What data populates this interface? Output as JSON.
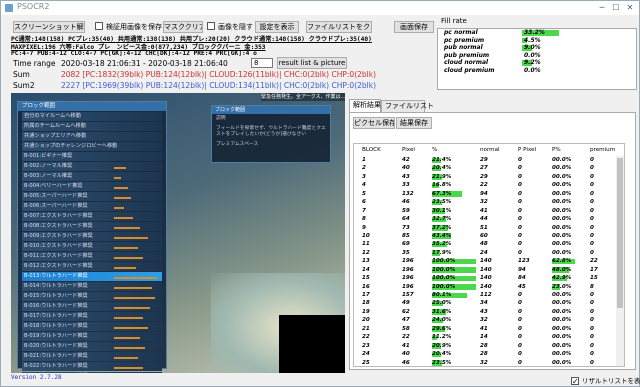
{
  "window": {
    "title": "PSOCR2"
  },
  "toolbar": {
    "screenshot_analyze": "スクリーンショット解析",
    "save_verify_image": "検証用画像を保存",
    "mask_clear": "マスククリア",
    "hide_image": "画像を隠す",
    "show_settings": "設定を表示",
    "clear_file_list": "ファイルリストをクリア",
    "save_screen": "画面保存"
  },
  "info_lines": [
    "PC通常:148(158) PCプレ:35(40) 共用通常:138(138) 共用プレ:20(20) クラウド通常:148(158) クラウドプレ:35(40)",
    "MAXPIXEL:196 六等:Falco プレ　ンピース金:0(877,234) ブロッククパーニ 金:353",
    "PC:4-7 PUB:4-12 CLO:4-7 PC[GK]:4-12 CHC[DK]:4-12 PRE:4 PRC[GK]:4 o"
  ],
  "time_range": {
    "label": "Time range",
    "value": "2020-03-18 21:06:31 - 2020-03-18 21:06:40",
    "field": "8",
    "result_button": "result list & picture"
  },
  "sum": {
    "label": "Sum",
    "value": "2082 [PC:1832(39blk) PUB:124(12blk)| CLOUD:126(11blk)| CHC:0(2blk) CHP:0(2blk)"
  },
  "sum2": {
    "label": "Sum2",
    "value": "2227 [PC:1969(39blk) PUB:124(12blk)| CLOUD:134(11blk)| CHC:0(2blk) CHP:0(2blk)"
  },
  "fill_rate": {
    "title": "Fill rate",
    "rows": [
      {
        "name": "pc normal",
        "value": "33.2%",
        "frac": 0.332
      },
      {
        "name": "pc premium",
        "value": "4.5%",
        "frac": 0.045
      },
      {
        "name": "pub normal",
        "value": "9.0%",
        "frac": 0.09
      },
      {
        "name": "pub premium",
        "value": "0.0%",
        "frac": 0
      },
      {
        "name": "cloud normal",
        "value": "9.2%",
        "frac": 0.092
      },
      {
        "name": "cloud premium",
        "value": "0.0%",
        "frac": 0
      }
    ]
  },
  "game": {
    "block_list_title": "ブロック範囲",
    "block_info_title": "ブロック範囲",
    "notice": "緊急任務発生。全アークス、作業は…",
    "info_label": "説明",
    "info_text": "フィールドを探索せず、ウルトラハード難度とクエストをプレイしたいか(どうか)選びなさい",
    "premium_label": "プレミアムスペース",
    "blocks": [
      {
        "label": "自分のマイルームへ移動",
        "level": 0
      },
      {
        "label": "所属のチームルームへ移動",
        "level": 0
      },
      {
        "label": "共通ショップエリアへ移動",
        "level": 0
      },
      {
        "label": "共通ショップのチャレンジロビーへ移動",
        "level": 0
      },
      {
        "label": "B-001:ビギナー推奨",
        "level": 0
      },
      {
        "label": "B-002:ノーマル推奨",
        "level": 0.25
      },
      {
        "label": "B-003:ノーマル推奨",
        "level": 0.15
      },
      {
        "label": "B-004:ベリーハード推奨",
        "level": 0.3
      },
      {
        "label": "B-005:スーパーハード推奨",
        "level": 0.35
      },
      {
        "label": "B-006:スーパーハード推奨",
        "level": 0.2
      },
      {
        "label": "B-007:エクストラハード推奨",
        "level": 0.4
      },
      {
        "label": "B-008:エクストラハード推奨",
        "level": 0.55
      },
      {
        "label": "B-009:エクストラハード推奨",
        "level": 0.7
      },
      {
        "label": "B-010:エクストラハード推奨",
        "level": 0.5
      },
      {
        "label": "B-011:エクストラハード推奨",
        "level": 0.6
      },
      {
        "label": "B-012:エクストラハード推奨",
        "level": 0.45
      },
      {
        "label": "B-013:ウルトラハード推奨",
        "level": 0.9
      },
      {
        "label": "B-014:ウルトラハード推奨",
        "level": 0.8
      },
      {
        "label": "B-015:ウルトラハード推奨",
        "level": 0.85
      },
      {
        "label": "B-016:ウルトラハード推奨",
        "level": 0.75
      },
      {
        "label": "B-017:ウルトラハード推奨",
        "level": 0.6
      },
      {
        "label": "B-018:ウルトラハード推奨",
        "level": 0.7
      },
      {
        "label": "B-019:ウルトラハード推奨",
        "level": 0.55
      },
      {
        "label": "B-020:ウルトラハード推奨",
        "level": 0.65
      },
      {
        "label": "B-021:ウルトラハード推奨",
        "level": 0.5
      },
      {
        "label": "B-022:ウルトラハード推奨",
        "level": 0.6
      },
      {
        "label": "B-023:ウルトラハード推奨",
        "level": 0.45
      }
    ],
    "selected_index": 16
  },
  "results": {
    "tabs": [
      "解析結果",
      "ファイルリスト"
    ],
    "pixel_save": "ピクセル保存",
    "result_save": "結果保存",
    "columns": [
      "BLOCK",
      "Pixel",
      "%",
      "normal",
      "P Pixel",
      "P%",
      "premium"
    ],
    "rows": [
      [
        "1",
        "42",
        "21.4%",
        "29",
        "0",
        "00.0%",
        "0"
      ],
      [
        "2",
        "40",
        "20.4%",
        "27",
        "0",
        "00.0%",
        "0"
      ],
      [
        "3",
        "43",
        "21.9%",
        "29",
        "0",
        "00.0%",
        "0"
      ],
      [
        "4",
        "33",
        "16.8%",
        "22",
        "0",
        "00.0%",
        "0"
      ],
      [
        "5",
        "132",
        "67.3%",
        "94",
        "0",
        "00.0%",
        "0"
      ],
      [
        "6",
        "46",
        "23.5%",
        "32",
        "0",
        "00.0%",
        "0"
      ],
      [
        "7",
        "59",
        "30.1%",
        "41",
        "0",
        "00.0%",
        "0"
      ],
      [
        "8",
        "64",
        "32.7%",
        "44",
        "0",
        "00.0%",
        "0"
      ],
      [
        "9",
        "73",
        "37.2%",
        "51",
        "0",
        "00.0%",
        "0"
      ],
      [
        "10",
        "85",
        "43.4%",
        "60",
        "0",
        "00.0%",
        "0"
      ],
      [
        "11",
        "69",
        "35.2%",
        "48",
        "0",
        "00.0%",
        "0"
      ],
      [
        "12",
        "35",
        "17.9%",
        "24",
        "0",
        "00.0%",
        "0"
      ],
      [
        "13",
        "196",
        "100.0%",
        "140",
        "123",
        "62.8%",
        "22"
      ],
      [
        "14",
        "196",
        "100.0%",
        "140",
        "94",
        "48.0%",
        "17"
      ],
      [
        "15",
        "196",
        "100.0%",
        "140",
        "84",
        "42.9%",
        "15"
      ],
      [
        "16",
        "196",
        "100.0%",
        "140",
        "45",
        "23.0%",
        "8"
      ],
      [
        "17",
        "157",
        "80.1%",
        "112",
        "0",
        "00.0%",
        "0"
      ],
      [
        "18",
        "49",
        "25.0%",
        "34",
        "0",
        "00.0%",
        "0"
      ],
      [
        "19",
        "62",
        "31.6%",
        "43",
        "0",
        "00.0%",
        "0"
      ],
      [
        "20",
        "47",
        "24.0%",
        "32",
        "0",
        "00.0%",
        "0"
      ],
      [
        "21",
        "58",
        "29.6%",
        "41",
        "0",
        "00.0%",
        "0"
      ],
      [
        "22",
        "22",
        "11.2%",
        "14",
        "0",
        "00.0%",
        "0"
      ],
      [
        "23",
        "41",
        "20.9%",
        "28",
        "0",
        "00.0%",
        "0"
      ],
      [
        "24",
        "40",
        "20.4%",
        "28",
        "0",
        "00.0%",
        "0"
      ],
      [
        "25",
        "46",
        "23.5%",
        "32",
        "0",
        "00.0%",
        "0"
      ]
    ]
  },
  "footer": {
    "version": "Version 2.7.28",
    "show_result_list": "リザルトリストを表示"
  },
  "colors": {
    "bar_green": "#4cd84c",
    "sum_red": "#d03030",
    "sum2_blue": "#3a5fd0"
  }
}
